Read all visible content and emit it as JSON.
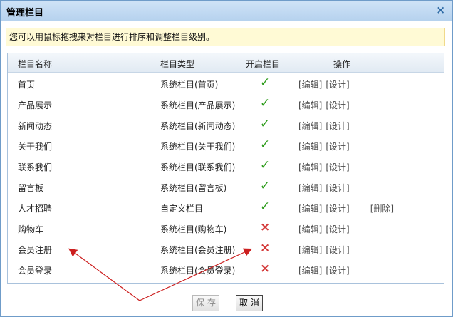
{
  "dialog": {
    "title": "管理栏目",
    "close": "×",
    "tip": "您可以用鼠标拖拽来对栏目进行排序和调整栏目级别。",
    "columns": {
      "name": "栏目名称",
      "type": "栏目类型",
      "enabled": "开启栏目",
      "actions": "操作"
    },
    "rows": [
      {
        "name": "首页",
        "type": "系统栏目(首页)",
        "enabled": true
      },
      {
        "name": "产品展示",
        "type": "系统栏目(产品展示)",
        "enabled": true
      },
      {
        "name": "新闻动态",
        "type": "系统栏目(新闻动态)",
        "enabled": true
      },
      {
        "name": "关于我们",
        "type": "系统栏目(关于我们)",
        "enabled": true
      },
      {
        "name": "联系我们",
        "type": "系统栏目(联系我们)",
        "enabled": true
      },
      {
        "name": "留言板",
        "type": "系统栏目(留言板)",
        "enabled": true
      },
      {
        "name": "人才招聘",
        "type": "自定义栏目",
        "enabled": true,
        "deletable": true
      },
      {
        "name": "购物车",
        "type": "系统栏目(购物车)",
        "enabled": false
      },
      {
        "name": "会员注册",
        "type": "系统栏目(会员注册)",
        "enabled": false
      },
      {
        "name": "会员登录",
        "type": "系统栏目(会员登录)",
        "enabled": false
      }
    ],
    "actions": {
      "edit": "[编辑]",
      "design": "[设计]",
      "delete": "[删除]"
    },
    "status_icons": {
      "enabled": "✓",
      "disabled": "×"
    },
    "buttons": {
      "save": "保 存",
      "cancel": "取 消"
    },
    "colors": {
      "check": "#2e9c1c",
      "cross": "#d43939",
      "tip_bg": "#fffad5",
      "annotation": "#cc1f1f"
    }
  }
}
